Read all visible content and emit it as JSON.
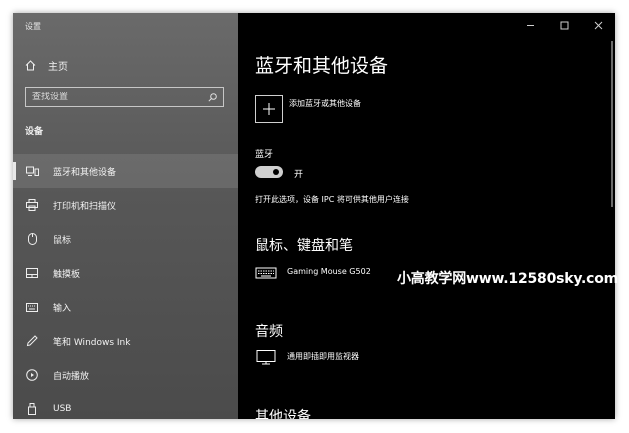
{
  "window": {
    "title": "设置",
    "controls": {
      "minimize": "–",
      "maximize": "☐",
      "close": "✕"
    }
  },
  "sidebar": {
    "home_label": "主页",
    "search_placeholder": "查找设置",
    "section_label": "设备",
    "items": [
      {
        "label": "蓝牙和其他设备",
        "icon": "bluetooth-devices-icon",
        "selected": true
      },
      {
        "label": "打印机和扫描仪",
        "icon": "printer-icon"
      },
      {
        "label": "鼠标",
        "icon": "mouse-icon"
      },
      {
        "label": "触摸板",
        "icon": "touchpad-icon"
      },
      {
        "label": "输入",
        "icon": "keyboard-icon"
      },
      {
        "label": "笔和 Windows Ink",
        "icon": "pen-icon"
      },
      {
        "label": "自动播放",
        "icon": "autoplay-icon"
      },
      {
        "label": "USB",
        "icon": "usb-icon"
      }
    ]
  },
  "main": {
    "title": "蓝牙和其他设备",
    "add_device_label": "添加蓝牙或其他设备",
    "bluetooth": {
      "label": "蓝牙",
      "toggle_state": "开",
      "toggle_on": true,
      "discoverable_text": "打开此选项，设备 IPC 将可供其他用户连接"
    },
    "sections": [
      {
        "heading": "鼠标、键盘和笔",
        "devices": [
          {
            "name": "Gaming Mouse G502",
            "icon": "keyboard-device-icon"
          }
        ]
      },
      {
        "heading": "音频",
        "devices": [
          {
            "name": "通用即插即用监视器",
            "icon": "monitor-icon"
          }
        ]
      },
      {
        "heading": "其他设备"
      }
    ]
  },
  "watermark": "小高教学网www.12580sky.com",
  "colors": {
    "sidebar": "#575757",
    "content": "#000000",
    "text": "#ffffff",
    "toggle": "#cfcfcf"
  }
}
